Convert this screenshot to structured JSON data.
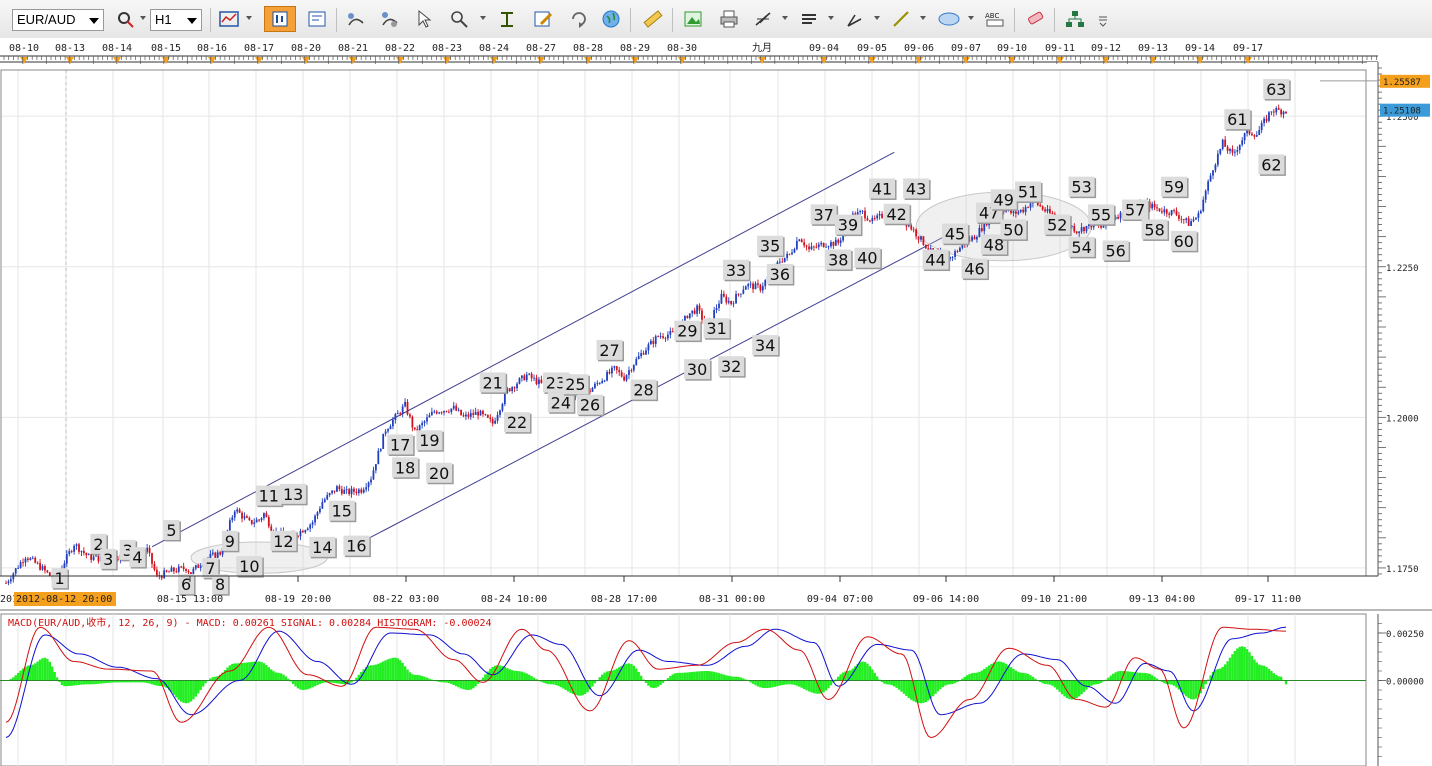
{
  "toolbar": {
    "symbol": "EUR/AUD",
    "timeframe": "H1",
    "tools": [
      {
        "name": "cursor-icon",
        "color": "#cc2222"
      },
      {
        "name": "chart-type-icon",
        "color": "#2255aa"
      },
      {
        "name": "candle-mode-icon",
        "color": "#1a4d99",
        "active": true
      },
      {
        "name": "template-icon",
        "color": "#2255aa"
      },
      {
        "name": "indicator-icon",
        "color": "#444444"
      },
      {
        "name": "indicator-settings-icon",
        "color": "#444444"
      },
      {
        "name": "cursor-select-icon",
        "color": "#444444"
      },
      {
        "name": "zoom-icon",
        "color": "#444444"
      },
      {
        "name": "text-tool-icon",
        "color": "#335500"
      },
      {
        "name": "edit-icon",
        "color": "#cc8800"
      },
      {
        "name": "refresh-icon",
        "color": "#666666"
      },
      {
        "name": "globe-icon",
        "color": "#2277cc"
      },
      {
        "name": "ruler-icon",
        "color": "#d4a21a"
      },
      {
        "name": "picture-icon",
        "color": "#339933"
      },
      {
        "name": "print-icon",
        "color": "#555555"
      },
      {
        "name": "fibonacci-icon",
        "color": "#333333"
      },
      {
        "name": "lines-icon",
        "color": "#333333"
      },
      {
        "name": "pen-icon",
        "color": "#333333"
      },
      {
        "name": "line-tool-icon",
        "color": "#9a8f00"
      },
      {
        "name": "ellipse-tool-icon",
        "color": "#3377cc"
      },
      {
        "name": "text-label-icon",
        "color": "#222222"
      },
      {
        "name": "eraser-icon",
        "color": "#cc3344"
      },
      {
        "name": "tree-icon",
        "color": "#227744"
      },
      {
        "name": "more-icon",
        "color": "#555555"
      }
    ],
    "text_label_glyph": "ABC"
  },
  "colors": {
    "bull": "#1f3fbf",
    "bear": "#d0101c",
    "channel": "#404090",
    "macd_line": "#d01010",
    "signal_line": "#1010d0",
    "histogram": "#22ee22",
    "price_tag": "#f4a01e",
    "current_tag": "#3a9bd8",
    "date_marker": "#f4a01e",
    "label_box": "#dcdcdc"
  },
  "top_dates": [
    "08-10",
    "08-13",
    "08-14",
    "08-15",
    "08-16",
    "08-17",
    "08-20",
    "08-21",
    "08-22",
    "08-23",
    "08-24",
    "08-27",
    "08-28",
    "08-29",
    "08-30",
    "九月",
    "09-04",
    "09-05",
    "09-06",
    "09-07",
    "09-10",
    "09-11",
    "09-12",
    "09-13",
    "09-14",
    "09-17"
  ],
  "bottom_dates": [
    "08-15 13:00",
    "08-19 20:00",
    "08-22 03:00",
    "08-24 10:00",
    "08-28 17:00",
    "08-31 00:00",
    "09-04 07:00",
    "09-06 14:00",
    "09-10 21:00",
    "09-13 04:00",
    "09-17 11:00"
  ],
  "bottom_start_partial": "201",
  "bottom_start_highlight": "2012-08-12 20:00",
  "price_tag_value": "1.25587",
  "current_price_value": "1.25108",
  "macd_title": "MACD(EUR/AUD,收市, 12, 26, 9) -  MACD: 0.00261  SIGNAL: 0.00284  HISTOGRAM: -0.00024",
  "macd_axis_labels": [
    "0.00250",
    "0.00000"
  ],
  "chart_data": {
    "type": "candlestick",
    "symbol": "EUR/AUD",
    "timeframe": "H1",
    "ylim": [
      1.172,
      1.258
    ],
    "y_ticks": [
      "1.1750",
      "1.2000",
      "1.2250",
      "1.2500"
    ],
    "close_path": [
      [
        0,
        1.1725
      ],
      [
        8,
        1.177
      ],
      [
        14,
        1.1752
      ],
      [
        20,
        1.173
      ],
      [
        28,
        1.179
      ],
      [
        34,
        1.1768
      ],
      [
        40,
        1.1765
      ],
      [
        46,
        1.177
      ],
      [
        52,
        1.1767
      ],
      [
        58,
        1.178
      ],
      [
        62,
        1.1735
      ],
      [
        68,
        1.1745
      ],
      [
        74,
        1.175
      ],
      [
        76,
        1.1742
      ],
      [
        82,
        1.1765
      ],
      [
        88,
        1.1775
      ],
      [
        94,
        1.1848
      ],
      [
        100,
        1.1825
      ],
      [
        104,
        1.183
      ],
      [
        106,
        1.184
      ],
      [
        110,
        1.181
      ],
      [
        116,
        1.18
      ],
      [
        120,
        1.1808
      ],
      [
        126,
        1.1826
      ],
      [
        130,
        1.186
      ],
      [
        136,
        1.1883
      ],
      [
        140,
        1.1875
      ],
      [
        146,
        1.188
      ],
      [
        150,
        1.19
      ],
      [
        156,
        1.198
      ],
      [
        164,
        1.202
      ],
      [
        168,
        1.1975
      ],
      [
        176,
        1.201
      ],
      [
        184,
        1.2015
      ],
      [
        188,
        1.2
      ],
      [
        194,
        1.2008
      ],
      [
        200,
        1.199
      ],
      [
        206,
        1.2045
      ],
      [
        214,
        1.207
      ],
      [
        220,
        1.2055
      ],
      [
        228,
        1.206
      ],
      [
        232,
        1.204
      ],
      [
        236,
        1.203
      ],
      [
        244,
        1.206
      ],
      [
        250,
        1.208
      ],
      [
        254,
        1.2066
      ],
      [
        258,
        1.209
      ],
      [
        262,
        1.211
      ],
      [
        268,
        1.2135
      ],
      [
        276,
        1.214
      ],
      [
        280,
        1.217
      ],
      [
        284,
        1.218
      ],
      [
        288,
        1.215
      ],
      [
        294,
        1.22
      ],
      [
        298,
        1.219
      ],
      [
        304,
        1.222
      ],
      [
        310,
        1.2215
      ],
      [
        318,
        1.226
      ],
      [
        322,
        1.227
      ],
      [
        326,
        1.23
      ],
      [
        330,
        1.2278
      ],
      [
        336,
        1.2288
      ],
      [
        342,
        1.229
      ],
      [
        348,
        1.2335
      ],
      [
        352,
        1.234
      ],
      [
        356,
        1.2325
      ],
      [
        364,
        1.2345
      ],
      [
        372,
        1.2315
      ],
      [
        380,
        1.2275
      ],
      [
        388,
        1.2265
      ],
      [
        394,
        1.229
      ],
      [
        398,
        1.23
      ],
      [
        404,
        1.233
      ],
      [
        408,
        1.235
      ],
      [
        414,
        1.2338
      ],
      [
        418,
        1.2345
      ],
      [
        422,
        1.236
      ],
      [
        428,
        1.234
      ],
      [
        434,
        1.233
      ],
      [
        440,
        1.231
      ],
      [
        446,
        1.232
      ],
      [
        450,
        1.2315
      ],
      [
        456,
        1.2335
      ],
      [
        462,
        1.234
      ],
      [
        468,
        1.2355
      ],
      [
        474,
        1.2345
      ],
      [
        480,
        1.234
      ],
      [
        486,
        1.2322
      ],
      [
        490,
        1.2335
      ],
      [
        496,
        1.2415
      ],
      [
        500,
        1.2455
      ],
      [
        504,
        1.2435
      ],
      [
        510,
        1.2475
      ],
      [
        514,
        1.247
      ],
      [
        520,
        1.251
      ],
      [
        524,
        1.2509
      ]
    ],
    "channel_upper": [
      [
        60,
        1.1785
      ],
      [
        365,
        1.244
      ]
    ],
    "channel_lower": [
      [
        140,
        1.178
      ],
      [
        395,
        1.232
      ]
    ],
    "annotations": [
      {
        "n": 1,
        "x": 22,
        "y": 1.1733
      },
      {
        "n": 2,
        "x": 38,
        "y": 1.179
      },
      {
        "n": 3,
        "x": 42,
        "y": 1.1765
      },
      {
        "n": 3,
        "x": 50,
        "y": 1.178
      },
      {
        "n": 4,
        "x": 54,
        "y": 1.1768
      },
      {
        "n": 5,
        "x": 68,
        "y": 1.1813
      },
      {
        "n": 6,
        "x": 74,
        "y": 1.1723
      },
      {
        "n": 7,
        "x": 84,
        "y": 1.175
      },
      {
        "n": 8,
        "x": 88,
        "y": 1.1723
      },
      {
        "n": 9,
        "x": 92,
        "y": 1.1795
      },
      {
        "n": 10,
        "x": 100,
        "y": 1.1753
      },
      {
        "n": 11,
        "x": 108,
        "y": 1.187
      },
      {
        "n": 12,
        "x": 114,
        "y": 1.1795
      },
      {
        "n": 13,
        "x": 118,
        "y": 1.1873
      },
      {
        "n": 14,
        "x": 130,
        "y": 1.1785
      },
      {
        "n": 15,
        "x": 138,
        "y": 1.1845
      },
      {
        "n": 16,
        "x": 144,
        "y": 1.1787
      },
      {
        "n": 17,
        "x": 162,
        "y": 1.1955
      },
      {
        "n": 18,
        "x": 164,
        "y": 1.1917
      },
      {
        "n": 19,
        "x": 174,
        "y": 1.1962
      },
      {
        "n": 20,
        "x": 178,
        "y": 1.1908
      },
      {
        "n": 21,
        "x": 200,
        "y": 1.2058
      },
      {
        "n": 22,
        "x": 210,
        "y": 1.1992
      },
      {
        "n": 23,
        "x": 226,
        "y": 1.2058
      },
      {
        "n": 24,
        "x": 228,
        "y": 1.2025
      },
      {
        "n": 25,
        "x": 234,
        "y": 1.2055
      },
      {
        "n": 26,
        "x": 240,
        "y": 1.2021
      },
      {
        "n": 27,
        "x": 248,
        "y": 1.2112
      },
      {
        "n": 28,
        "x": 262,
        "y": 1.2046
      },
      {
        "n": 29,
        "x": 280,
        "y": 1.2144
      },
      {
        "n": 30,
        "x": 284,
        "y": 1.208
      },
      {
        "n": 31,
        "x": 292,
        "y": 1.2148
      },
      {
        "n": 32,
        "x": 298,
        "y": 1.2085
      },
      {
        "n": 33,
        "x": 300,
        "y": 1.2245
      },
      {
        "n": 34,
        "x": 312,
        "y": 1.212
      },
      {
        "n": 35,
        "x": 314,
        "y": 1.2285
      },
      {
        "n": 36,
        "x": 318,
        "y": 1.2238
      },
      {
        "n": 37,
        "x": 336,
        "y": 1.2337
      },
      {
        "n": 38,
        "x": 342,
        "y": 1.2262
      },
      {
        "n": 39,
        "x": 346,
        "y": 1.232
      },
      {
        "n": 40,
        "x": 354,
        "y": 1.2265
      },
      {
        "n": 41,
        "x": 360,
        "y": 1.238
      },
      {
        "n": 42,
        "x": 366,
        "y": 1.2338
      },
      {
        "n": 43,
        "x": 374,
        "y": 1.238
      },
      {
        "n": 44,
        "x": 382,
        "y": 1.2262
      },
      {
        "n": 45,
        "x": 390,
        "y": 1.2305
      },
      {
        "n": 46,
        "x": 398,
        "y": 1.2247
      },
      {
        "n": 47,
        "x": 404,
        "y": 1.234
      },
      {
        "n": 48,
        "x": 406,
        "y": 1.2287
      },
      {
        "n": 49,
        "x": 410,
        "y": 1.2362
      },
      {
        "n": 50,
        "x": 414,
        "y": 1.2312
      },
      {
        "n": 51,
        "x": 420,
        "y": 1.2375
      },
      {
        "n": 52,
        "x": 432,
        "y": 1.232
      },
      {
        "n": 53,
        "x": 442,
        "y": 1.2383
      },
      {
        "n": 54,
        "x": 442,
        "y": 1.2283
      },
      {
        "n": 55,
        "x": 450,
        "y": 1.2337
      },
      {
        "n": 56,
        "x": 456,
        "y": 1.2277
      },
      {
        "n": 57,
        "x": 464,
        "y": 1.2345
      },
      {
        "n": 58,
        "x": 472,
        "y": 1.2312
      },
      {
        "n": 59,
        "x": 480,
        "y": 1.2383
      },
      {
        "n": 60,
        "x": 484,
        "y": 1.2293
      },
      {
        "n": 61,
        "x": 506,
        "y": 1.2495
      },
      {
        "n": 62,
        "x": 520,
        "y": 1.242
      },
      {
        "n": 63,
        "x": 522,
        "y": 1.2545
      }
    ],
    "ellipses": [
      {
        "cx": 104,
        "cy": 1.1767,
        "rx": 28,
        "ry": 0.0026
      },
      {
        "cx": 410,
        "cy": 1.2317,
        "rx": 36,
        "ry": 0.0057
      }
    ],
    "macd": {
      "ylim": [
        -0.0045,
        0.0035
      ],
      "macd_path": [
        [
          0,
          -0.0022
        ],
        [
          14,
          0.0028
        ],
        [
          28,
          0.001
        ],
        [
          42,
          0.0006
        ],
        [
          60,
          0.0005
        ],
        [
          72,
          -0.0022
        ],
        [
          92,
          0.0005
        ],
        [
          108,
          0.0028
        ],
        [
          124,
          0.0003
        ],
        [
          138,
          -0.0003
        ],
        [
          152,
          0.0028
        ],
        [
          168,
          0.0027
        ],
        [
          184,
          0.0011
        ],
        [
          196,
          -0.0001
        ],
        [
          212,
          0.0027
        ],
        [
          222,
          0.0016
        ],
        [
          240,
          -0.0016
        ],
        [
          256,
          0.0021
        ],
        [
          268,
          0.0006
        ],
        [
          284,
          0.0008
        ],
        [
          300,
          0.002
        ],
        [
          312,
          0.0027
        ],
        [
          326,
          0.0016
        ],
        [
          338,
          -0.001
        ],
        [
          354,
          0.0023
        ],
        [
          368,
          0.0014
        ],
        [
          380,
          -0.003
        ],
        [
          396,
          -0.001
        ],
        [
          412,
          0.0017
        ],
        [
          428,
          0.0008
        ],
        [
          440,
          -0.001
        ],
        [
          452,
          -0.0014
        ],
        [
          464,
          0.0012
        ],
        [
          474,
          0.0006
        ],
        [
          484,
          -0.0025
        ],
        [
          500,
          0.0028
        ],
        [
          512,
          0.0027
        ],
        [
          526,
          0.0026
        ]
      ],
      "signal_path": [
        [
          0,
          -0.003
        ],
        [
          16,
          0.0024
        ],
        [
          30,
          0.0014
        ],
        [
          46,
          0.0007
        ],
        [
          62,
          0.0001
        ],
        [
          76,
          -0.0018
        ],
        [
          96,
          0.0
        ],
        [
          112,
          0.0026
        ],
        [
          128,
          0.001
        ],
        [
          142,
          -0.0002
        ],
        [
          158,
          0.0025
        ],
        [
          174,
          0.0024
        ],
        [
          188,
          0.0014
        ],
        [
          200,
          0.0003
        ],
        [
          216,
          0.0024
        ],
        [
          228,
          0.0019
        ],
        [
          244,
          -0.0008
        ],
        [
          260,
          0.0016
        ],
        [
          272,
          0.001
        ],
        [
          288,
          0.0008
        ],
        [
          304,
          0.0018
        ],
        [
          316,
          0.0027
        ],
        [
          332,
          0.002
        ],
        [
          342,
          -0.0003
        ],
        [
          358,
          0.0019
        ],
        [
          372,
          0.0016
        ],
        [
          384,
          -0.0018
        ],
        [
          400,
          -0.0012
        ],
        [
          418,
          0.0014
        ],
        [
          432,
          0.0011
        ],
        [
          444,
          -0.0003
        ],
        [
          456,
          -0.0012
        ],
        [
          468,
          0.0009
        ],
        [
          478,
          0.0005
        ],
        [
          488,
          -0.0016
        ],
        [
          504,
          0.0022
        ],
        [
          516,
          0.0025
        ],
        [
          526,
          0.0028
        ]
      ],
      "histogram_path": [
        [
          0,
          0.0
        ],
        [
          10,
          0.0008
        ],
        [
          16,
          0.0012
        ],
        [
          24,
          -0.0003
        ],
        [
          34,
          -0.0002
        ],
        [
          46,
          -0.0001
        ],
        [
          56,
          -0.0001
        ],
        [
          64,
          -0.0003
        ],
        [
          74,
          -0.0012
        ],
        [
          86,
          0.0002
        ],
        [
          94,
          0.0009
        ],
        [
          104,
          0.001
        ],
        [
          112,
          0.0004
        ],
        [
          122,
          -0.0005
        ],
        [
          132,
          -0.0001
        ],
        [
          140,
          -0.0002
        ],
        [
          150,
          0.0008
        ],
        [
          160,
          0.0012
        ],
        [
          168,
          0.0003
        ],
        [
          180,
          -0.0001
        ],
        [
          190,
          -0.0005
        ],
        [
          202,
          0.0008
        ],
        [
          210,
          0.0005
        ],
        [
          224,
          -0.0002
        ],
        [
          236,
          -0.0008
        ],
        [
          248,
          0.0005
        ],
        [
          256,
          0.0009
        ],
        [
          266,
          -0.0004
        ],
        [
          276,
          0.0004
        ],
        [
          288,
          0.0005
        ],
        [
          300,
          0.0002
        ],
        [
          312,
          -0.0004
        ],
        [
          322,
          -0.0002
        ],
        [
          334,
          -0.0007
        ],
        [
          346,
          0.0005
        ],
        [
          352,
          0.001
        ],
        [
          362,
          -0.0002
        ],
        [
          376,
          -0.0012
        ],
        [
          388,
          -0.0002
        ],
        [
          398,
          0.0004
        ],
        [
          408,
          0.001
        ],
        [
          418,
          0.0004
        ],
        [
          428,
          -0.0002
        ],
        [
          438,
          -0.001
        ],
        [
          448,
          -0.0002
        ],
        [
          458,
          0.0005
        ],
        [
          468,
          0.0004
        ],
        [
          478,
          -0.0002
        ],
        [
          488,
          -0.001
        ],
        [
          498,
          0.0006
        ],
        [
          508,
          0.0018
        ],
        [
          516,
          0.0008
        ],
        [
          524,
          0.0002
        ],
        [
          526,
          -0.0002
        ]
      ]
    }
  }
}
